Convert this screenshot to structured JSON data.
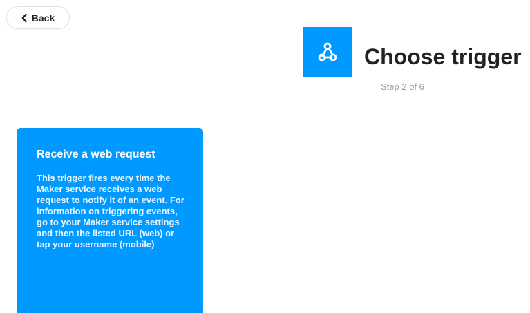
{
  "header": {
    "back_label": "Back",
    "title": "Choose trigger",
    "step": "Step 2 of 6"
  },
  "service": {
    "icon": "webhooks-icon",
    "color": "#0099ff"
  },
  "triggers": [
    {
      "title": "Receive a web request",
      "description": "This trigger fires every time the Maker service receives a web request to notify it of an event. For information on triggering events, go to your Maker service settings and then the listed URL (web) or tap your username (mobile)",
      "color": "#0099ff"
    }
  ]
}
